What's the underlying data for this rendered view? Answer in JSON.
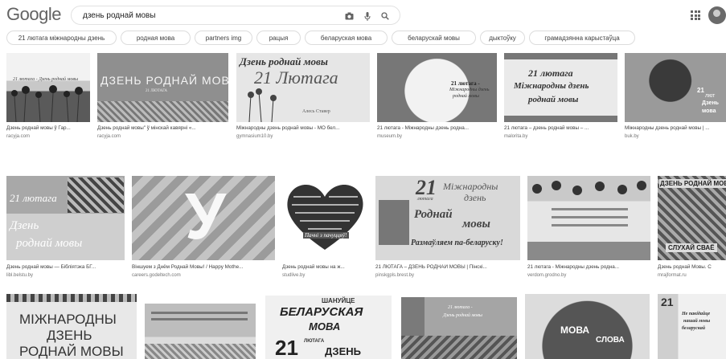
{
  "header": {
    "logo_text": "Google",
    "search_value": "дзень роднай мовы",
    "icons": [
      "camera-icon",
      "microphone-icon",
      "search-icon",
      "apps-icon",
      "account-avatar"
    ]
  },
  "chips": [
    "21 лютага міжнародны дзень",
    "родная мова",
    "partners img",
    "рацыя",
    "беларуская мова",
    "беларускай мовы",
    "дыктоўку",
    "грамадзянна карыстаўца"
  ],
  "row1": [
    {
      "caption": "Дзень роднай мовы ў Гар...",
      "source": "racyja.com",
      "texts": [
        "21 лютага - Дзень роднай мовы"
      ]
    },
    {
      "caption": "Дзень роднай мовы\" ў мінскай кавярні «...",
      "source": "racyja.com",
      "texts": [
        "ДЗЕНЬ РОДНАЙ МОВЫ",
        "21 ЛЮТАГА"
      ]
    },
    {
      "caption": "Міжнародны дзень роднай мовы - МО бел...",
      "source": "gymnasium10.by",
      "texts": [
        "Дзень роднай мовы",
        "21 Лютага",
        "Алесь Ставер"
      ]
    },
    {
      "caption": "21 лютага - Міжнародны дзень родна...",
      "source": "museum.by",
      "texts": [
        "21 лютага -",
        "Міжнародны дзень",
        "роднай мовы"
      ]
    },
    {
      "caption": "21 лютага – дзень роднай мовы – ...",
      "source": "malorita.by",
      "texts": [
        "21 лютага",
        "Міжнародны дзень",
        "роднай мовы"
      ]
    },
    {
      "caption": "Міжнародны дзень роднай мовы | ...",
      "source": "buk.by",
      "texts": [
        "21",
        "лют",
        "Дзень",
        "мова"
      ]
    }
  ],
  "row2": [
    {
      "caption": "Дзень роднай мовы — Бібліятэка БГ...",
      "source": "libl.belstu.by",
      "texts": [
        "21 лютага",
        "Дзень",
        "роднай мовы"
      ]
    },
    {
      "caption": "Віншуем з Днём Роднай Мовы! / Happy Mothe...",
      "source": "careers.godeltech.com",
      "texts": [
        "У"
      ]
    },
    {
      "caption": "Дзень роднай мовы на ж...",
      "source": "studlive.by",
      "texts": [
        "Пачні з пачуццяў!"
      ]
    },
    {
      "caption": "21 ЛЮТАГА – ДЗЕНЬ РОДНАЙ МОВЫ | Пінскі...",
      "source": "pinskgpls.brest.by",
      "texts": [
        "21",
        "лютага",
        "Міжнародны",
        "дзень",
        "Роднай",
        "мовы",
        "Размаўляем па-беларуску!"
      ]
    },
    {
      "caption": "21 лютага - Міжнародны дзень родна...",
      "source": "verdom.grodno.by",
      "texts": []
    },
    {
      "caption": "Дзень роднай Мовы. С",
      "source": "mrajformat.ru",
      "texts": [
        "ДЗЕНЬ РОДНАЙ МОВЫ",
        "СЛУХАЙ СВАЁ"
      ]
    }
  ],
  "row3": [
    {
      "texts": [
        "МІЖНАРОДНЫ",
        "ДЗЕНЬ",
        "РОДНАЙ МОВЫ"
      ]
    },
    {
      "texts": []
    },
    {
      "texts": [
        "ШАНУЙЦЕ",
        "БЕЛАРУСКАЯ",
        "МОВА",
        "21",
        "ЛЮТАГА",
        "ДЗЕНЬ"
      ]
    },
    {
      "texts": [
        "21 лютага -",
        "Дзень роднай мовы"
      ]
    },
    {
      "texts": [
        "МОВА",
        "СЛОВА"
      ]
    },
    {
      "texts": [
        "21",
        "Не пакідайце",
        "нашай мовы",
        "беларускай"
      ]
    }
  ]
}
